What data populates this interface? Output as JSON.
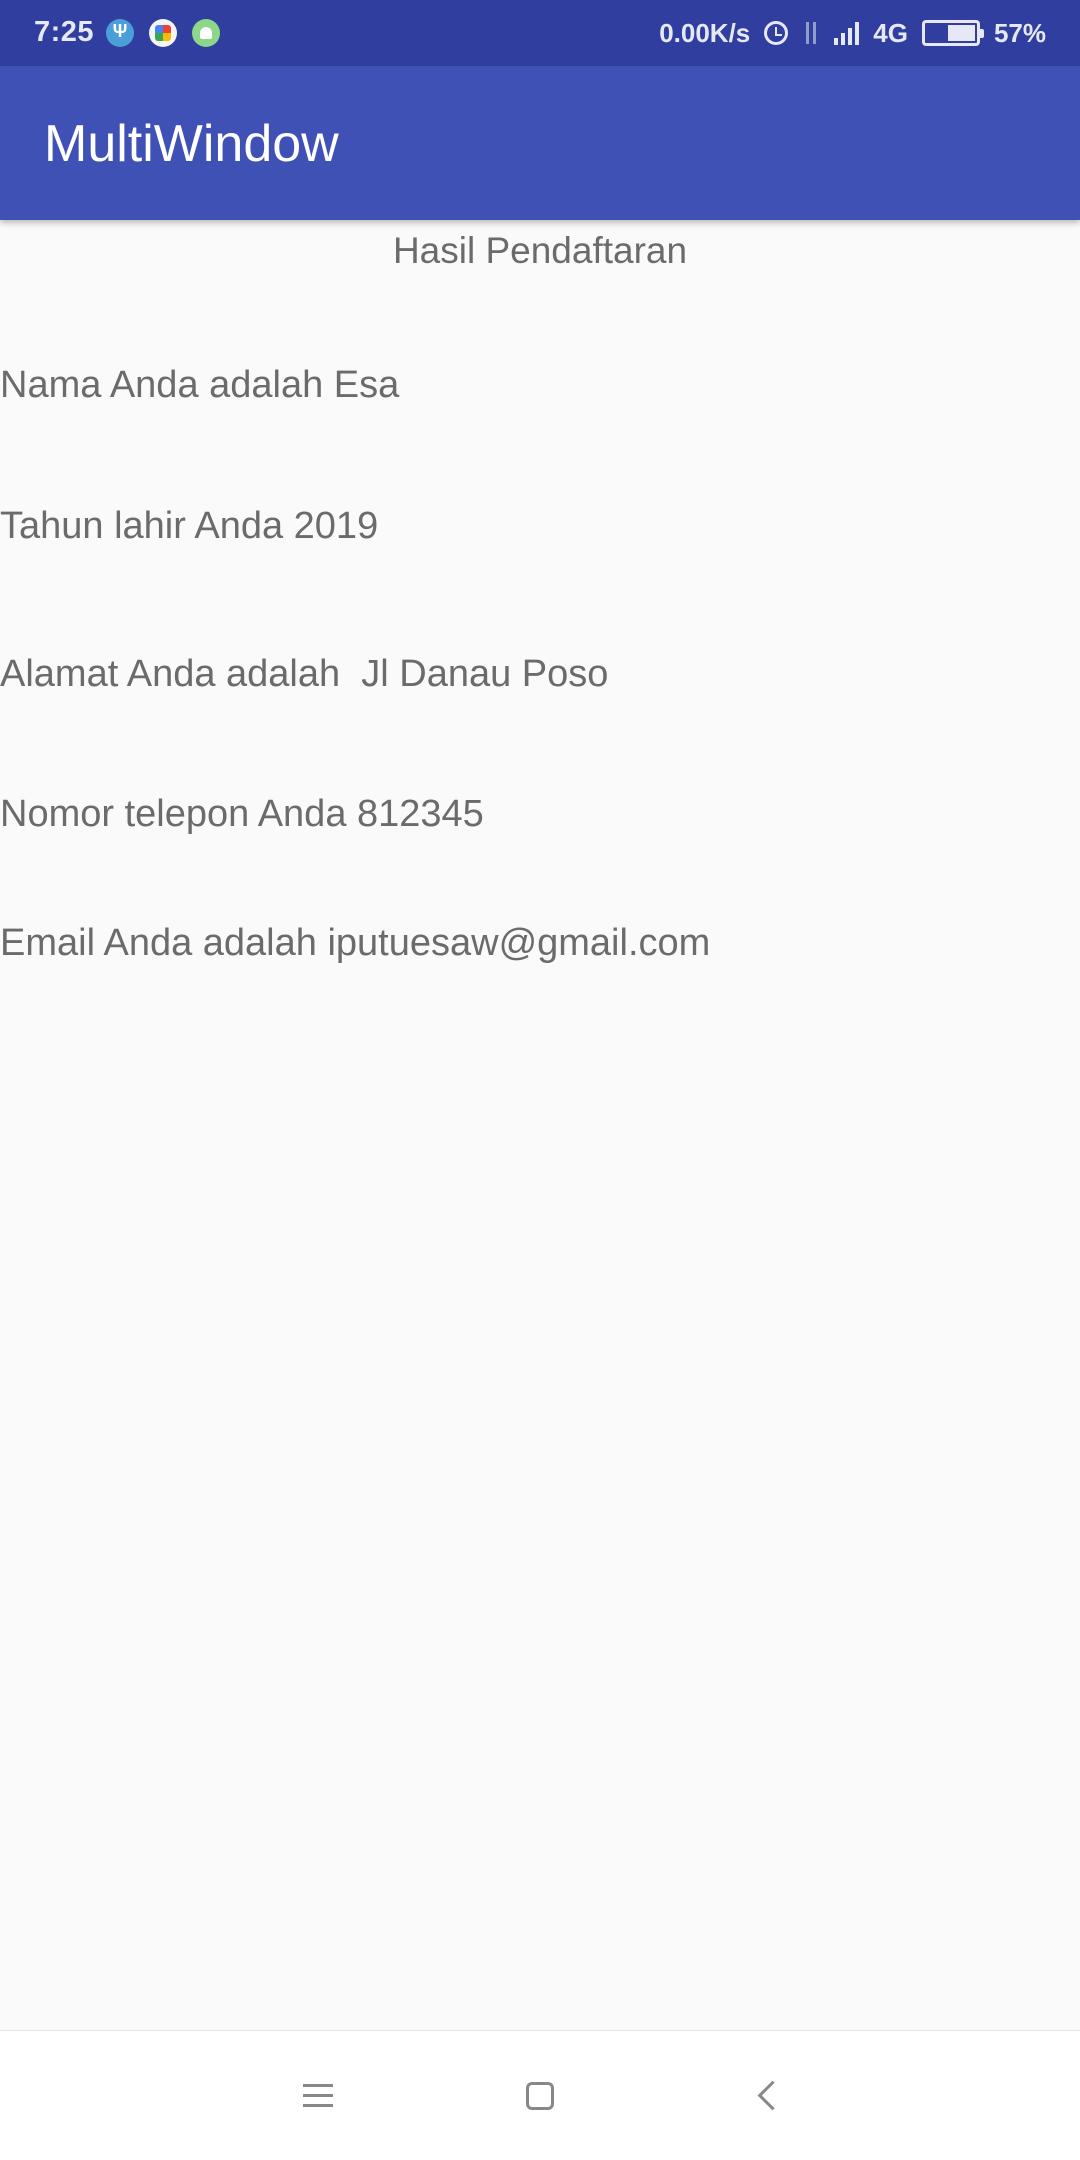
{
  "status_bar": {
    "time": "7:25",
    "network_speed": "0.00K/s",
    "network_type": "4G",
    "battery_percent": "57%",
    "battery_level": 0.57,
    "icons": [
      "usb-icon",
      "puzzle-icon",
      "android-icon",
      "alarm-icon",
      "data-arrows-icon",
      "signal-icon",
      "battery-icon"
    ]
  },
  "app_bar": {
    "title": "MultiWindow",
    "color": "#3f51b5"
  },
  "content": {
    "heading": "Hasil Pendaftaran",
    "lines": [
      "Nama Anda adalah Esa",
      "Tahun lahir Anda 2019",
      "Alamat Anda adalah  Jl Danau Poso",
      "Nomor telepon Anda 812345",
      "Email Anda adalah iputuesaw@gmail.com"
    ]
  },
  "nav_bar": {
    "icons": [
      "menu-icon",
      "home-icon",
      "back-icon"
    ]
  },
  "colors": {
    "status_bar": "#303f9f",
    "primary": "#3f51b5",
    "text": "#6b6b6b",
    "background": "#fafafa"
  }
}
